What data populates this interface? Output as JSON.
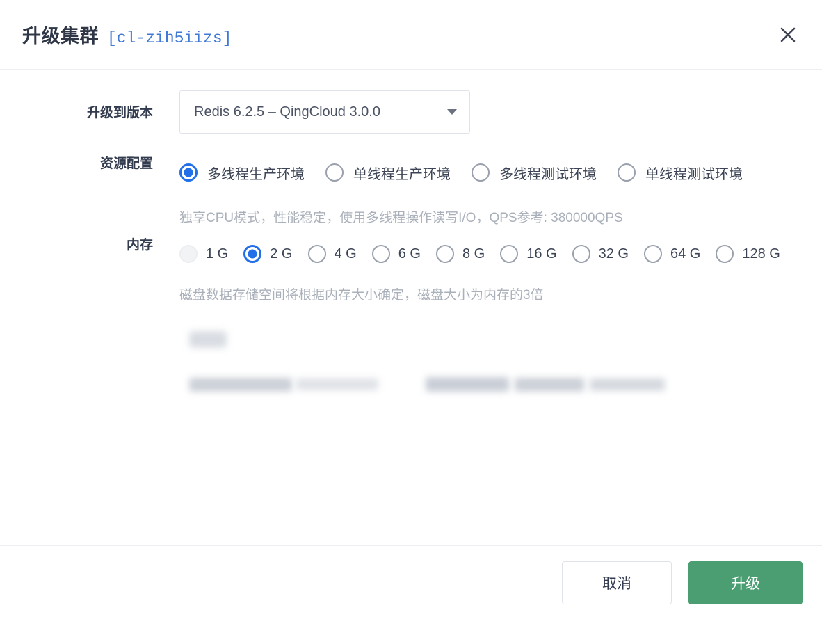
{
  "dialog": {
    "title": "升级集群",
    "cluster_id": "[cl-zih5iizs]",
    "close_icon": "close-icon"
  },
  "version": {
    "label": "升级到版本",
    "selected": "Redis 6.2.5 – QingCloud 3.0.0",
    "caret_icon": "chevron-down-icon"
  },
  "resource": {
    "label": "资源配置",
    "options": [
      {
        "label": "多线程生产环境",
        "checked": true,
        "disabled": false
      },
      {
        "label": "单线程生产环境",
        "checked": false,
        "disabled": false
      },
      {
        "label": "多线程测试环境",
        "checked": false,
        "disabled": false
      },
      {
        "label": "单线程测试环境",
        "checked": false,
        "disabled": false
      }
    ],
    "hint": "独享CPU模式，性能稳定，使用多线程操作读写I/O，QPS参考: 380000QPS"
  },
  "memory": {
    "label": "内存",
    "options": [
      {
        "label": "1 G",
        "checked": false,
        "disabled": true
      },
      {
        "label": "2 G",
        "checked": true,
        "disabled": false
      },
      {
        "label": "4 G",
        "checked": false,
        "disabled": false
      },
      {
        "label": "6 G",
        "checked": false,
        "disabled": false
      },
      {
        "label": "8 G",
        "checked": false,
        "disabled": false
      },
      {
        "label": "16 G",
        "checked": false,
        "disabled": false
      },
      {
        "label": "32 G",
        "checked": false,
        "disabled": false
      },
      {
        "label": "64 G",
        "checked": false,
        "disabled": false
      },
      {
        "label": "128 G",
        "checked": false,
        "disabled": false
      }
    ],
    "hint": "磁盘数据存储空间将根据内存大小确定，磁盘大小为内存的3倍"
  },
  "redacted": {
    "note": ""
  },
  "footer": {
    "cancel_label": "取消",
    "confirm_label": "升级"
  },
  "colors": {
    "accent_blue": "#2170e8",
    "link_blue": "#3f79d4",
    "primary_green": "#4a9e72",
    "text_dark": "#333b4f",
    "text_muted": "#aab0ba",
    "border": "#dfe3e9"
  }
}
